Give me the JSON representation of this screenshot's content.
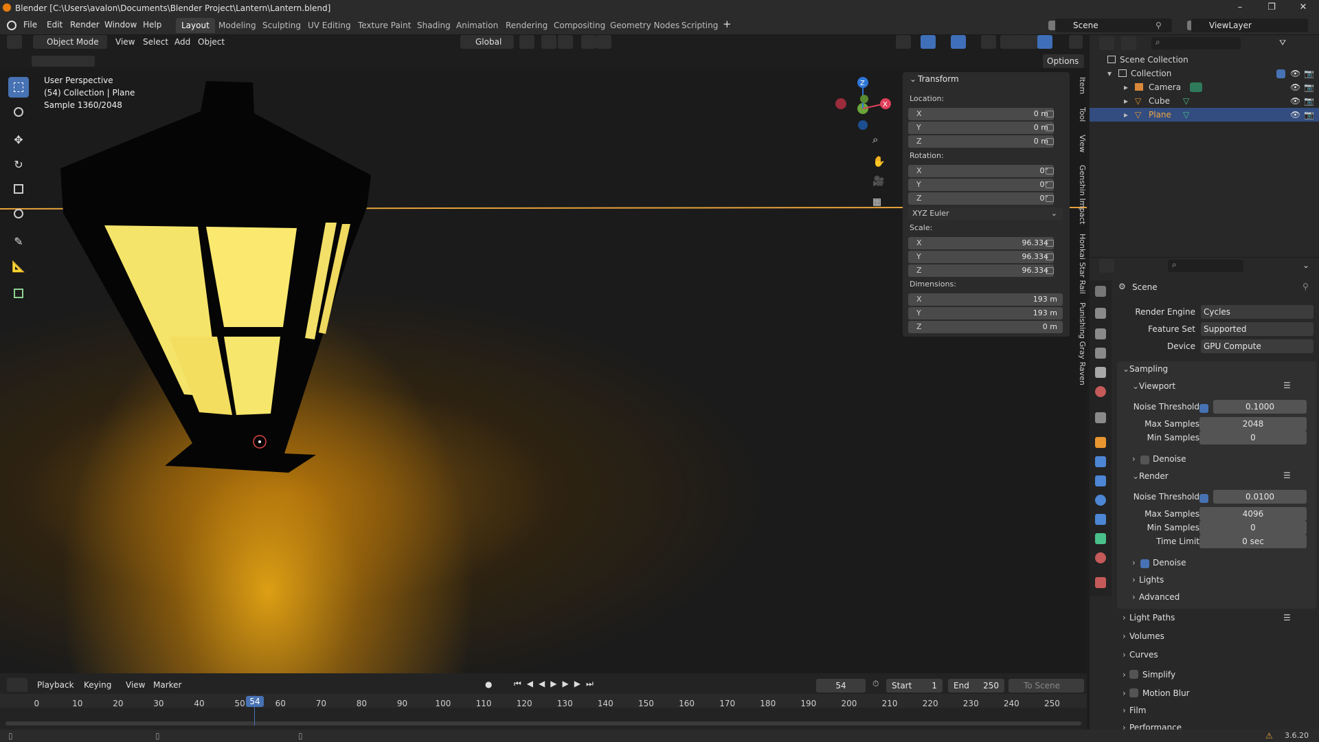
{
  "window": {
    "title": "Blender [C:\\Users\\avalon\\Documents\\Blender Project\\Lantern\\Lantern.blend]"
  },
  "menu": [
    "File",
    "Edit",
    "Render",
    "Window",
    "Help"
  ],
  "workspaces": [
    {
      "label": "Layout",
      "active": true
    },
    {
      "label": "Modeling"
    },
    {
      "label": "Sculpting"
    },
    {
      "label": "UV Editing"
    },
    {
      "label": "Texture Paint"
    },
    {
      "label": "Shading"
    },
    {
      "label": "Animation"
    },
    {
      "label": "Rendering"
    },
    {
      "label": "Compositing"
    },
    {
      "label": "Geometry Nodes"
    },
    {
      "label": "Scripting"
    }
  ],
  "scene": {
    "name": "Scene",
    "view_layer": "ViewLayer"
  },
  "viewport_header": {
    "mode": "Object Mode",
    "menus": [
      "View",
      "Select",
      "Add",
      "Object"
    ],
    "orientation": "Global",
    "options": "Options"
  },
  "viewport_overlay": {
    "line1": "User Perspective",
    "line2": "(54) Collection | Plane",
    "line3": "Sample 1360/2048"
  },
  "transform": {
    "title": "Transform",
    "location": {
      "label": "Location:",
      "x": "0 m",
      "y": "0 m",
      "z": "0 m"
    },
    "rotation": {
      "label": "Rotation:",
      "x": "0°",
      "y": "0°",
      "z": "0°"
    },
    "rotation_mode": "XYZ Euler",
    "scale": {
      "label": "Scale:",
      "x": "96.334",
      "y": "96.334",
      "z": "96.334"
    },
    "dimensions": {
      "label": "Dimensions:",
      "x": "193 m",
      "y": "193 m",
      "z": "0 m"
    },
    "axes": {
      "x": "X",
      "y": "Y",
      "z": "Z"
    }
  },
  "sidebar_tabs": [
    "Item",
    "Tool",
    "View",
    "Genshin Impact",
    "Honkai Star Rail",
    "Punishing Gray Raven"
  ],
  "outliner": {
    "root": "Scene Collection",
    "collection": "Collection",
    "objects": [
      {
        "name": "Camera"
      },
      {
        "name": "Cube"
      },
      {
        "name": "Plane",
        "selected": true
      }
    ]
  },
  "properties": {
    "context": "Scene",
    "render_engine": {
      "label": "Render Engine",
      "value": "Cycles"
    },
    "feature_set": {
      "label": "Feature Set",
      "value": "Supported"
    },
    "device": {
      "label": "Device",
      "value": "GPU Compute"
    },
    "sampling": "Sampling",
    "viewport": {
      "title": "Viewport",
      "noise_label": "Noise Threshold",
      "noise": "0.1000",
      "max_label": "Max Samples",
      "max": "2048",
      "min_label": "Min Samples",
      "min": "0",
      "denoise": "Denoise"
    },
    "render": {
      "title": "Render",
      "noise_label": "Noise Threshold",
      "noise": "0.0100",
      "max_label": "Max Samples",
      "max": "4096",
      "min_label": "Min Samples",
      "min": "0",
      "time_label": "Time Limit",
      "time": "0 sec",
      "denoise": "Denoise"
    },
    "sections": [
      "Lights",
      "Advanced"
    ],
    "panels": [
      "Light Paths",
      "Volumes",
      "Curves",
      "Simplify",
      "Motion Blur",
      "Film",
      "Performance"
    ]
  },
  "timeline": {
    "menus": [
      "Playback",
      "Keying",
      "View",
      "Marker"
    ],
    "current_frame": "54",
    "start_label": "Start",
    "start": "1",
    "end_label": "End",
    "end": "250",
    "range": "To Scene Range",
    "ticks": [
      "0",
      "10",
      "20",
      "30",
      "40",
      "50",
      "60",
      "70",
      "80",
      "90",
      "100",
      "110",
      "120",
      "130",
      "140",
      "150",
      "160",
      "170",
      "180",
      "190",
      "200",
      "210",
      "220",
      "230",
      "240",
      "250"
    ]
  },
  "status": {
    "version": "3.6.20"
  },
  "colors": {
    "accent": "#4772b3",
    "selection": "#334d80",
    "lamp_glow": "#f5e46a",
    "horizon": "#e8a23a"
  }
}
